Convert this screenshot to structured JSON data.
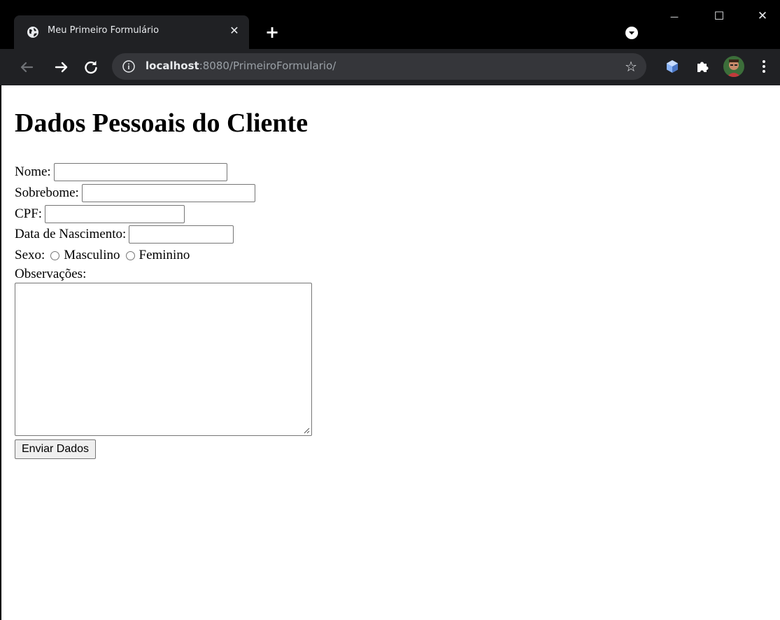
{
  "browser": {
    "tab": {
      "title": "Meu Primeiro Formulário",
      "close_glyph": "✕",
      "icon": "globe-icon"
    },
    "new_tab_glyph": "+",
    "window_controls": {
      "minimize_glyph": "—",
      "maximize_glyph": "☐",
      "close_glyph": "✕"
    },
    "address": {
      "host": "localhost",
      "rest": ":8080/PrimeiroFormulario/"
    },
    "bookmark_glyph": "☆",
    "colors": {
      "tabstrip_bg": "#000000",
      "toolbar_bg": "#202124",
      "omnibox_bg": "#35363a",
      "text": "#e8eaed",
      "muted": "#9aa0a6"
    }
  },
  "form": {
    "heading": "Dados Pessoais do Cliente",
    "fields": {
      "nome_label": "Nome:",
      "sobrenome_label": "Sobrebome:",
      "cpf_label": "CPF:",
      "nascimento_label": "Data de Nascimento:",
      "sexo_label": "Sexo:",
      "sexo_options": [
        "Masculino",
        "Feminino"
      ],
      "observacoes_label": "Observações:"
    },
    "values": {
      "nome": "",
      "sobrenome": "",
      "cpf": "",
      "nascimento": "",
      "observacoes": ""
    },
    "submit_label": "Enviar Dados"
  }
}
